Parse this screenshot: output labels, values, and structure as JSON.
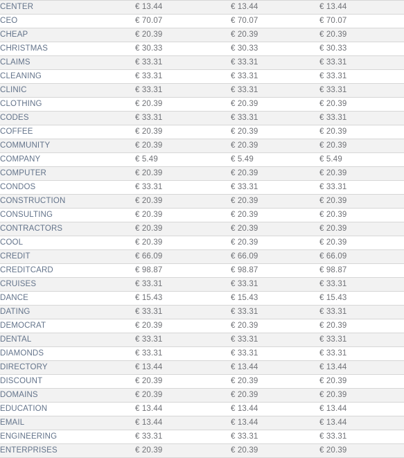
{
  "table": {
    "currency_symbol": "€",
    "columns": [
      "tld",
      "price_1",
      "price_2",
      "price_3"
    ],
    "rows": [
      {
        "tld": "CENTER",
        "price_1": "€ 13.44",
        "price_2": "€ 13.44",
        "price_3": "€ 13.44"
      },
      {
        "tld": "CEO",
        "price_1": "€ 70.07",
        "price_2": "€ 70.07",
        "price_3": "€ 70.07"
      },
      {
        "tld": "CHEAP",
        "price_1": "€ 20.39",
        "price_2": "€ 20.39",
        "price_3": "€ 20.39"
      },
      {
        "tld": "CHRISTMAS",
        "price_1": "€ 30.33",
        "price_2": "€ 30.33",
        "price_3": "€ 30.33"
      },
      {
        "tld": "CLAIMS",
        "price_1": "€ 33.31",
        "price_2": "€ 33.31",
        "price_3": "€ 33.31"
      },
      {
        "tld": "CLEANING",
        "price_1": "€ 33.31",
        "price_2": "€ 33.31",
        "price_3": "€ 33.31"
      },
      {
        "tld": "CLINIC",
        "price_1": "€ 33.31",
        "price_2": "€ 33.31",
        "price_3": "€ 33.31"
      },
      {
        "tld": "CLOTHING",
        "price_1": "€ 20.39",
        "price_2": "€ 20.39",
        "price_3": "€ 20.39"
      },
      {
        "tld": "CODES",
        "price_1": "€ 33.31",
        "price_2": "€ 33.31",
        "price_3": "€ 33.31"
      },
      {
        "tld": "COFFEE",
        "price_1": "€ 20.39",
        "price_2": "€ 20.39",
        "price_3": "€ 20.39"
      },
      {
        "tld": "COMMUNITY",
        "price_1": "€ 20.39",
        "price_2": "€ 20.39",
        "price_3": "€ 20.39"
      },
      {
        "tld": "COMPANY",
        "price_1": "€ 5.49",
        "price_2": "€ 5.49",
        "price_3": "€ 5.49"
      },
      {
        "tld": "COMPUTER",
        "price_1": "€ 20.39",
        "price_2": "€ 20.39",
        "price_3": "€ 20.39"
      },
      {
        "tld": "CONDOS",
        "price_1": "€ 33.31",
        "price_2": "€ 33.31",
        "price_3": "€ 33.31"
      },
      {
        "tld": "CONSTRUCTION",
        "price_1": "€ 20.39",
        "price_2": "€ 20.39",
        "price_3": "€ 20.39"
      },
      {
        "tld": "CONSULTING",
        "price_1": "€ 20.39",
        "price_2": "€ 20.39",
        "price_3": "€ 20.39"
      },
      {
        "tld": "CONTRACTORS",
        "price_1": "€ 20.39",
        "price_2": "€ 20.39",
        "price_3": "€ 20.39"
      },
      {
        "tld": "COOL",
        "price_1": "€ 20.39",
        "price_2": "€ 20.39",
        "price_3": "€ 20.39"
      },
      {
        "tld": "CREDIT",
        "price_1": "€ 66.09",
        "price_2": "€ 66.09",
        "price_3": "€ 66.09"
      },
      {
        "tld": "CREDITCARD",
        "price_1": "€ 98.87",
        "price_2": "€ 98.87",
        "price_3": "€ 98.87"
      },
      {
        "tld": "CRUISES",
        "price_1": "€ 33.31",
        "price_2": "€ 33.31",
        "price_3": "€ 33.31"
      },
      {
        "tld": "DANCE",
        "price_1": "€ 15.43",
        "price_2": "€ 15.43",
        "price_3": "€ 15.43"
      },
      {
        "tld": "DATING",
        "price_1": "€ 33.31",
        "price_2": "€ 33.31",
        "price_3": "€ 33.31"
      },
      {
        "tld": "DEMOCRAT",
        "price_1": "€ 20.39",
        "price_2": "€ 20.39",
        "price_3": "€ 20.39"
      },
      {
        "tld": "DENTAL",
        "price_1": "€ 33.31",
        "price_2": "€ 33.31",
        "price_3": "€ 33.31"
      },
      {
        "tld": "DIAMONDS",
        "price_1": "€ 33.31",
        "price_2": "€ 33.31",
        "price_3": "€ 33.31"
      },
      {
        "tld": "DIRECTORY",
        "price_1": "€ 13.44",
        "price_2": "€ 13.44",
        "price_3": "€ 13.44"
      },
      {
        "tld": "DISCOUNT",
        "price_1": "€ 20.39",
        "price_2": "€ 20.39",
        "price_3": "€ 20.39"
      },
      {
        "tld": "DOMAINS",
        "price_1": "€ 20.39",
        "price_2": "€ 20.39",
        "price_3": "€ 20.39"
      },
      {
        "tld": "EDUCATION",
        "price_1": "€ 13.44",
        "price_2": "€ 13.44",
        "price_3": "€ 13.44"
      },
      {
        "tld": "EMAIL",
        "price_1": "€ 13.44",
        "price_2": "€ 13.44",
        "price_3": "€ 13.44"
      },
      {
        "tld": "ENGINEERING",
        "price_1": "€ 33.31",
        "price_2": "€ 33.31",
        "price_3": "€ 33.31"
      },
      {
        "tld": "ENTERPRISES",
        "price_1": "€ 20.39",
        "price_2": "€ 20.39",
        "price_3": "€ 20.39"
      }
    ]
  },
  "colors": {
    "row_shaded_bg": "#f2f2f2",
    "row_plain_bg": "#ffffff",
    "row_border": "#d6d6d6",
    "tld_text": "#64748b",
    "price_text": "#6f7176"
  }
}
